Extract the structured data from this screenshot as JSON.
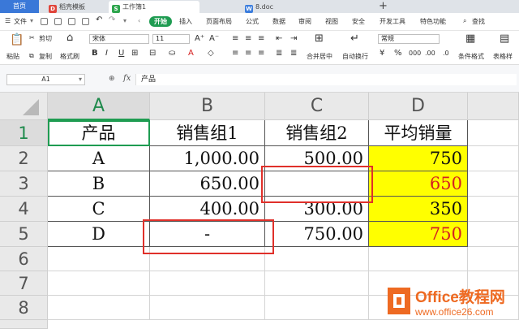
{
  "tabs": {
    "home": "首页",
    "template": "稻壳模板",
    "workbook": "工作簿1",
    "doc": "8.doc",
    "new_tab": "+"
  },
  "menu": {
    "file": "文件",
    "start": "开始",
    "items": [
      "插入",
      "页面布局",
      "公式",
      "数据",
      "审阅",
      "视图",
      "安全",
      "开发工具",
      "特色功能"
    ],
    "search": "查找"
  },
  "ribbon": {
    "paste": "粘贴",
    "cut": "剪切",
    "copy": "复制",
    "format_painter": "格式刷",
    "font_name": "宋体",
    "font_size": "11",
    "merge_center": "合并居中",
    "wrap_text": "自动换行",
    "number_format": "常规",
    "conditional_format": "条件格式",
    "table_style": "表格样"
  },
  "formula_bar": {
    "cell_ref": "A1",
    "fx": "fx",
    "content": "产品"
  },
  "columns": [
    "A",
    "B",
    "C",
    "D"
  ],
  "rows": [
    "1",
    "2",
    "3",
    "4",
    "5",
    "6",
    "7",
    "8"
  ],
  "table": {
    "header": [
      "产品",
      "销售组1",
      "销售组2",
      "平均销量"
    ],
    "data": [
      [
        "A",
        "1,000.00",
        "500.00",
        "750"
      ],
      [
        "B",
        "650.00",
        "",
        "650"
      ],
      [
        "C",
        "400.00",
        "300.00",
        "350"
      ],
      [
        "D",
        "-",
        "750.00",
        "750"
      ]
    ]
  },
  "colors": {
    "accent_green": "#1f9c52",
    "highlight_yellow": "#ffff00",
    "annotation_red": "#e0302a",
    "watermark_orange": "#ee6a22"
  },
  "watermark": {
    "title": "Office教程网",
    "url": "www.office26.com"
  }
}
